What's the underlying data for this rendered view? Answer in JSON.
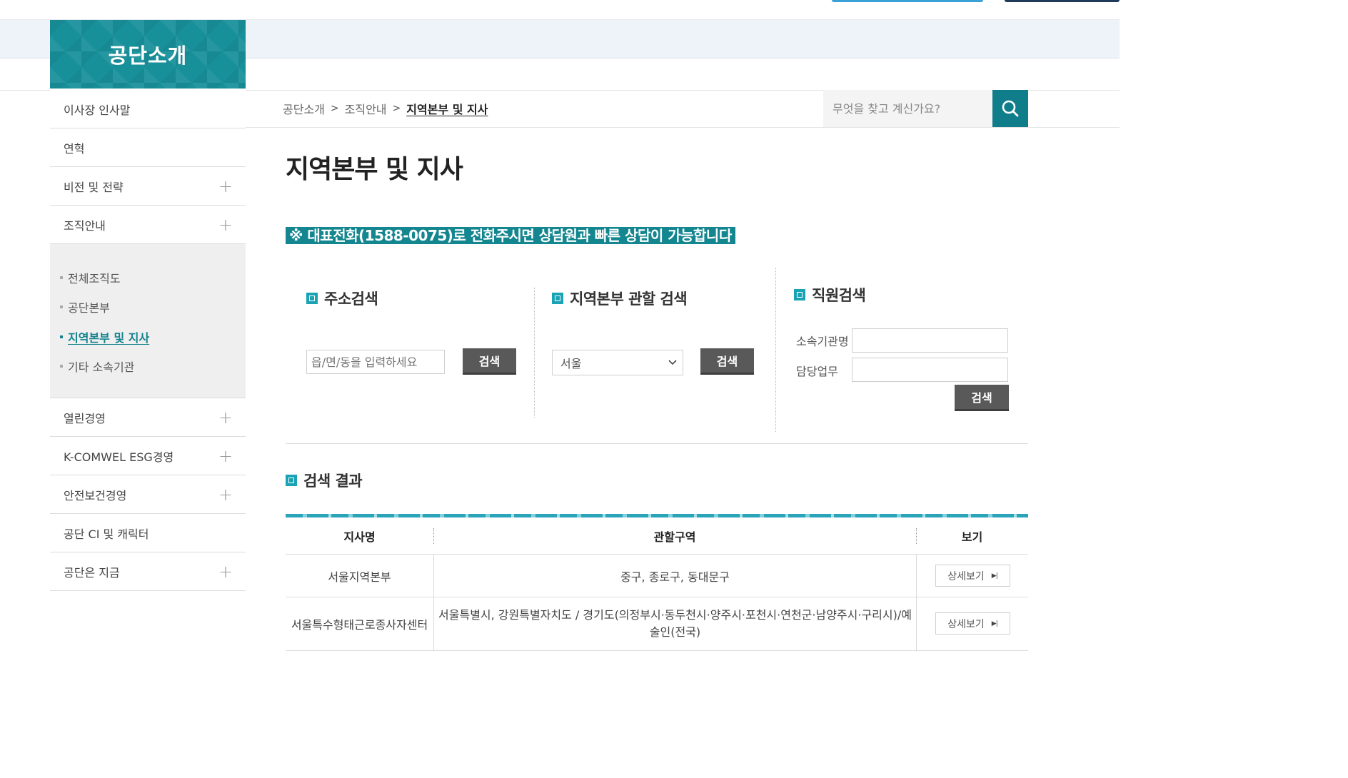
{
  "header": {
    "section_title": "공단소개"
  },
  "sidebar": {
    "items_top": [
      {
        "label": "이사장 인사말",
        "has_plus": false
      },
      {
        "label": "연혁",
        "has_plus": false
      },
      {
        "label": "비전 및 전략",
        "has_plus": true
      },
      {
        "label": "조직안내",
        "has_plus": true
      }
    ],
    "submenu": [
      {
        "label": "전체조직도",
        "active": false
      },
      {
        "label": "공단본부",
        "active": false
      },
      {
        "label": "지역본부 및 지사",
        "active": true
      },
      {
        "label": "기타 소속기관",
        "active": false
      }
    ],
    "items_bottom": [
      {
        "label": "열린경영",
        "has_plus": true
      },
      {
        "label": "K-COMWEL ESG경영",
        "has_plus": true
      },
      {
        "label": "안전보건경영",
        "has_plus": true
      },
      {
        "label": "공단 CI 및 캐릭터",
        "has_plus": false
      },
      {
        "label": "공단은 지금",
        "has_plus": true
      }
    ],
    "plus_symbol": "+"
  },
  "breadcrumb": {
    "items": [
      "공단소개",
      "조직안내",
      "지역본부 및 지사"
    ],
    "separator": ">"
  },
  "top_search": {
    "placeholder": "무엇을 찾고 계신가요?",
    "icon": "search-icon"
  },
  "page": {
    "title": "지역본부 및 지사",
    "notice": "※ 대표전화(1588-0075)로 전화주시면 상담원과 빠른 상담이 가능합니다"
  },
  "address_search": {
    "title": "주소검색",
    "placeholder": "읍/면/동을 입력하세요",
    "button": "검색"
  },
  "region_search": {
    "title": "지역본부 관할 검색",
    "selected": "서울",
    "button": "검색"
  },
  "staff_search": {
    "title": "직원검색",
    "org_label": "소속기관명",
    "duty_label": "담당업무",
    "button": "검색"
  },
  "results": {
    "title": "검색 결과",
    "columns": [
      "지사명",
      "관할구역",
      "보기"
    ],
    "rows": [
      {
        "name": "서울지역본부",
        "area": "중구, 종로구, 동대문구",
        "action": "상세보기"
      },
      {
        "name": "서울특수형태근로종사자센터",
        "area": "서울특별시, 강원특별자치도 / 경기도(의정부시·동두천시·양주시·포천시·연천군·남양주시·구리시)/예술인(전국)",
        "action": "상세보기"
      }
    ]
  },
  "colors": {
    "accent": "#13868f",
    "button_dark": "#595959",
    "search_btn": "#0f7e8a"
  }
}
